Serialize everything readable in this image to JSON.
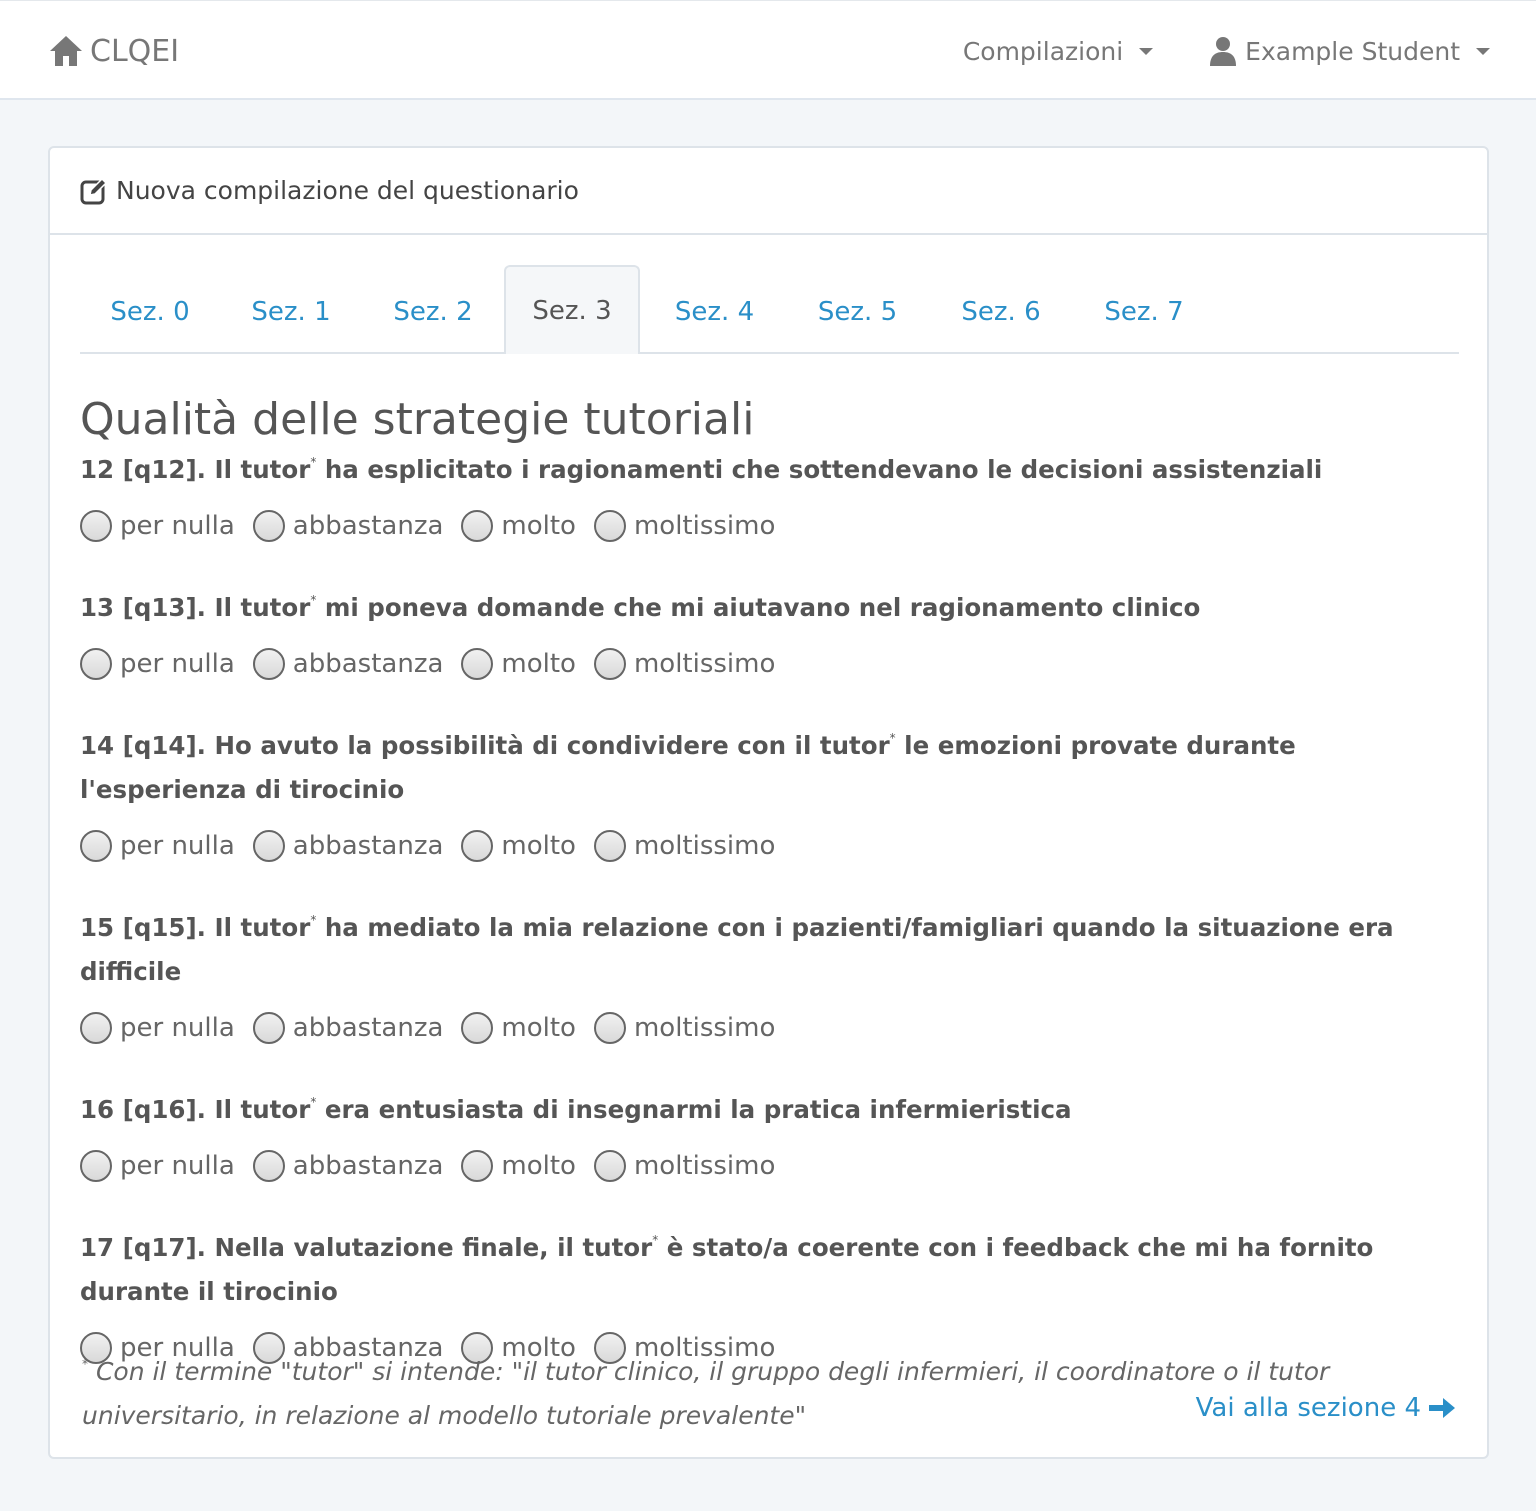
{
  "navbar": {
    "brand": "CLQEI",
    "brand_icon": "home-icon",
    "menu_compilazioni": "Compilazioni",
    "user_name": "Example Student",
    "user_icon": "user-icon"
  },
  "panel": {
    "heading": "Nuova compilazione del questionario",
    "heading_icon": "edit-icon"
  },
  "tabs": [
    {
      "label": "Sez. 0",
      "active": false
    },
    {
      "label": "Sez. 1",
      "active": false
    },
    {
      "label": "Sez. 2",
      "active": false
    },
    {
      "label": "Sez. 3",
      "active": true
    },
    {
      "label": "Sez. 4",
      "active": false
    },
    {
      "label": "Sez. 5",
      "active": false
    },
    {
      "label": "Sez. 6",
      "active": false
    },
    {
      "label": "Sez. 7",
      "active": false
    }
  ],
  "section": {
    "title": "Qualità delle strategie tutoriali",
    "options": [
      "per nulla",
      "abbastanza",
      "molto",
      "moltissimo"
    ],
    "questions": [
      {
        "pre": "12 [q12]. Il tutor",
        "mark": "*",
        "post": " ha esplicitato i ragionamenti che sottendevano le decisioni assistenziali"
      },
      {
        "pre": "13 [q13]. Il tutor",
        "mark": "*",
        "post": " mi poneva domande che mi aiutavano nel ragionamento clinico"
      },
      {
        "pre": "14 [q14]. Ho avuto la possibilità di condividere con il tutor",
        "mark": "*",
        "post": " le emozioni provate durante l'esperienza di tirocinio"
      },
      {
        "pre": "15 [q15]. Il tutor",
        "mark": "*",
        "post": " ha mediato la mia relazione con i pazienti/famigliari quando la situazione era difficile"
      },
      {
        "pre": "16 [q16]. Il tutor",
        "mark": "*",
        "post": " era entusiasta di insegnarmi la pratica infermieristica"
      },
      {
        "pre": "17 [q17]. Nella valutazione finale, il tutor",
        "mark": "*",
        "post": " è stato/a coerente con i feedback che mi ha fornito durante il tirocinio"
      }
    ]
  },
  "footnote": {
    "mark": "*",
    "text": " Con il termine \"tutor\" si intende: \"il tutor clinico, il gruppo degli infermieri, il coordinatore o il tutor universitario, in relazione al modello tutoriale prevalente\""
  },
  "next_link": {
    "label": "Vai alla sezione 4",
    "icon": "arrow-right-icon"
  }
}
